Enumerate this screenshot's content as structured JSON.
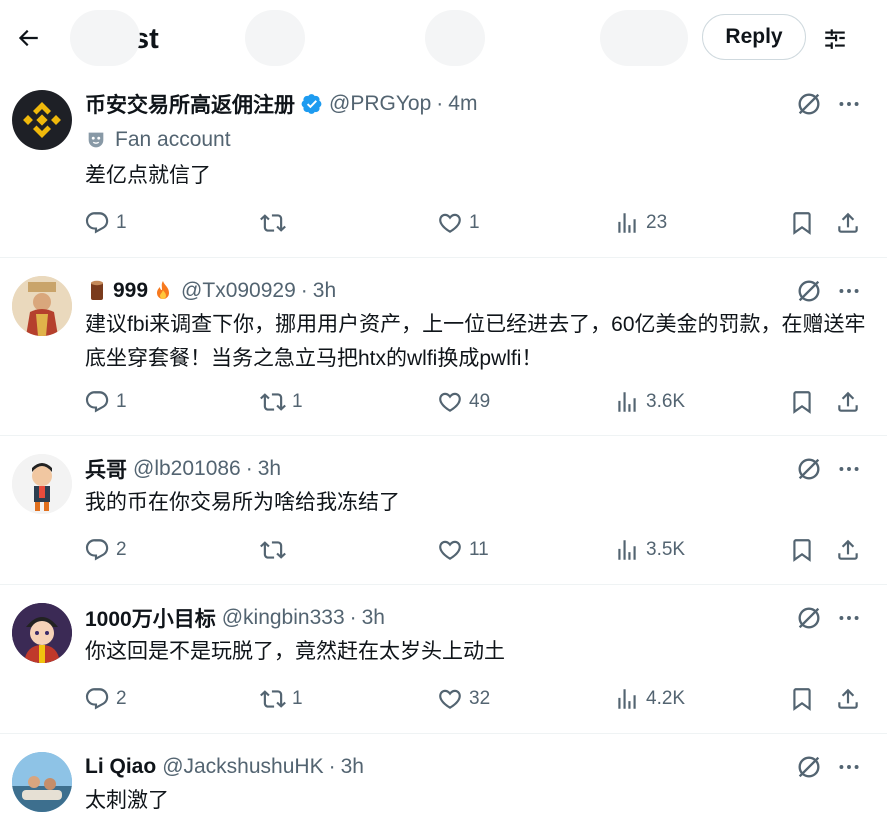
{
  "header": {
    "title": "Post",
    "reply_label": "Reply"
  },
  "posts": [
    {
      "name": "币安交易所高返佣注册",
      "verified": true,
      "handle": "@PRGYop",
      "sep": "·",
      "time": "4m",
      "fan_label": "Fan account",
      "text": "差亿点就信了",
      "replies": "1",
      "reposts": "",
      "likes": "1",
      "views": "23"
    },
    {
      "name": "999",
      "handle": "@Tx090929",
      "sep": "·",
      "time": "3h",
      "text": "建议fbi来调查下你，挪用用户资产，上一位已经进去了，60亿美金的罚款，在赠送牢底坐穿套餐！当务之急立马把htx的wlfi换成pwlfi！",
      "replies": "1",
      "reposts": "1",
      "likes": "49",
      "views": "3.6K"
    },
    {
      "name": "兵哥",
      "handle": "@lb201086",
      "sep": "·",
      "time": "3h",
      "text": "我的币在你交易所为啥给我冻结了",
      "replies": "2",
      "reposts": "",
      "likes": "11",
      "views": "3.5K"
    },
    {
      "name": "1000万小目标",
      "handle": "@kingbin333",
      "sep": "·",
      "time": "3h",
      "text": "你这回是不是玩脱了，竟然赶在太岁头上动土",
      "replies": "2",
      "reposts": "1",
      "likes": "32",
      "views": "4.2K"
    },
    {
      "name": "Li Qiao",
      "handle": "@JackshushuHK",
      "sep": "·",
      "time": "3h",
      "text": "太刺激了"
    }
  ],
  "icons": {
    "back": "arrow-left-icon",
    "tune": "sliders-icon",
    "grok": "grok-icon",
    "more": "more-dots-icon",
    "reply": "reply-icon",
    "repost": "repost-icon",
    "like": "heart-icon",
    "views": "views-icon",
    "bookmark": "bookmark-icon",
    "share": "share-icon"
  },
  "colors": {
    "text": "#0f1419",
    "secondary": "#536471",
    "verified": "#1d9bf0",
    "binance": "#f0b90b"
  }
}
